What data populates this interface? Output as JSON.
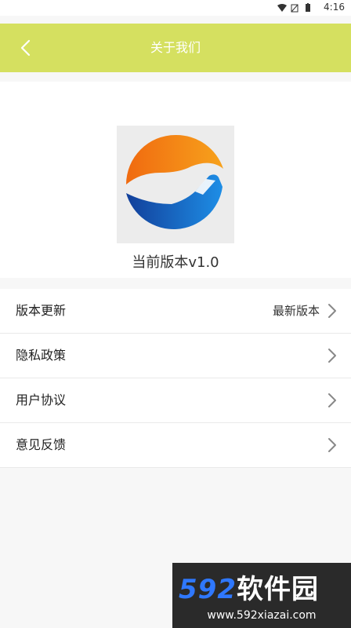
{
  "status": {
    "time": "4:16"
  },
  "header": {
    "title": "关于我们"
  },
  "app": {
    "version_text": "当前版本v1.0"
  },
  "menu": {
    "items": [
      {
        "label": "版本更新",
        "value": "最新版本"
      },
      {
        "label": "隐私政策"
      },
      {
        "label": "用户协议"
      },
      {
        "label": "意见反馈"
      }
    ]
  },
  "watermark": {
    "brand_num": "592",
    "brand_text": "软件园",
    "url": "www.592xiazai.com"
  },
  "colors": {
    "accent": "#d5e060",
    "logo_orange": "#f17a12",
    "logo_blue": "#1a62b8"
  }
}
